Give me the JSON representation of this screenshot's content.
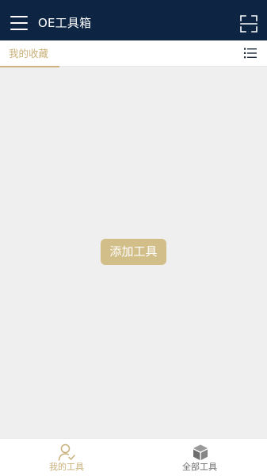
{
  "header": {
    "title": "OE工具箱",
    "menu_icon": "hamburger-menu-icon",
    "scan_icon": "scan-icon"
  },
  "tabs": {
    "favorites_label": "我的收藏",
    "list_icon": "list-view-icon"
  },
  "main": {
    "add_tool_label": "添加工具"
  },
  "bottom_nav": {
    "items": [
      {
        "label": "我的工具",
        "icon": "user-check-icon",
        "active": true
      },
      {
        "label": "全部工具",
        "icon": "cube-icon",
        "active": false
      }
    ]
  },
  "colors": {
    "header_bg": "#0d2542",
    "accent": "#cdb27e",
    "button_bg": "#d2be89",
    "page_bg": "#efefef"
  }
}
